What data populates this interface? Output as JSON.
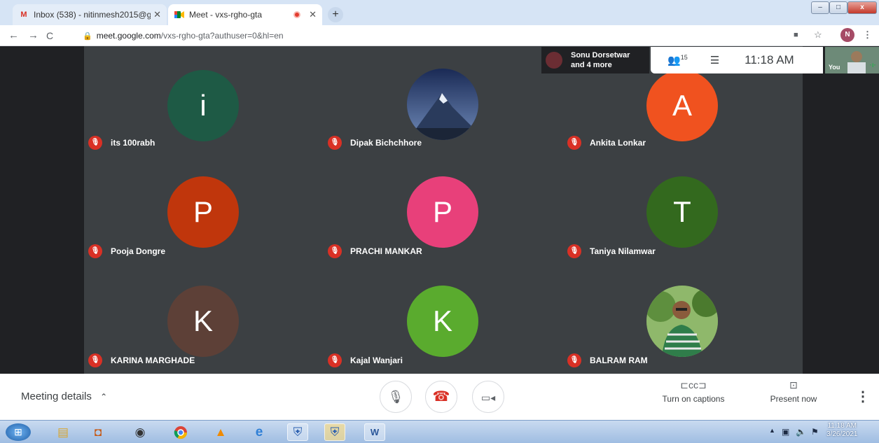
{
  "browser": {
    "tabs": [
      {
        "favicon": "M",
        "title": "Inbox (538) - nitinmesh2015@g",
        "active": false
      },
      {
        "favicon": "meet-icon",
        "title": "Meet - vxs-rgho-gta",
        "active": true
      }
    ],
    "new_tab": "+",
    "window_controls": {
      "minimize": "–",
      "maximize": "□",
      "close": "x"
    },
    "url_host": "meet.google.com",
    "url_path": "/vxs-rgho-gta?authuser=0&hl=en",
    "profile_initial": "N"
  },
  "meet": {
    "speaking": {
      "line1": "Sonu Dorsetwar",
      "line2": "and 4 more"
    },
    "participants_count": "15",
    "time": "11:18 AM",
    "self_label": "You",
    "tiles": [
      {
        "initial": "i",
        "name": "its 100rabh",
        "color": "#1e5a45",
        "photo": false
      },
      {
        "initial": "",
        "name": "Dipak Bichchhore",
        "color": "#243a6b",
        "photo": true
      },
      {
        "initial": "A",
        "name": "Ankita Lonkar",
        "color": "#f0521f",
        "photo": false
      },
      {
        "initial": "P",
        "name": "Pooja Dongre",
        "color": "#c0360c",
        "photo": false
      },
      {
        "initial": "P",
        "name": "PRACHI MANKAR",
        "color": "#e8407a",
        "photo": false
      },
      {
        "initial": "T",
        "name": "Taniya Nilamwar",
        "color": "#33691e",
        "photo": false
      },
      {
        "initial": "K",
        "name": "KARINA MARGHADE",
        "color": "#5d4037",
        "photo": false
      },
      {
        "initial": "K",
        "name": "Kajal Wanjari",
        "color": "#5aab2e",
        "photo": false
      },
      {
        "initial": "",
        "name": "BALRAM RAM",
        "color": "#4e7a3a",
        "photo": true
      }
    ],
    "bottom": {
      "meeting_details": "Meeting details",
      "captions": "Turn on captions",
      "present": "Present now",
      "more": "⋮"
    }
  },
  "taskbar": {
    "clock_time": "11:18 AM",
    "clock_date": "3/26/2021"
  }
}
